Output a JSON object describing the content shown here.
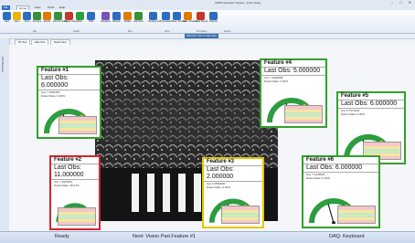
{
  "window": {
    "title": "CMM Inspection System - [Live View]",
    "controls": [
      "–",
      "□",
      "✕"
    ]
  },
  "menu": {
    "tabs": [
      "File",
      "Home",
      "View",
      "Tools",
      "Help"
    ],
    "active": 1
  },
  "ribbon": {
    "buttons": [
      "New",
      "Open",
      "Save",
      "Rename",
      "Export",
      "Recent Library",
      "Delete Library",
      "Part",
      "Hold",
      "Hardware",
      "Refresh",
      "Rotate",
      "Start Run",
      "Viewing Grid",
      "Translation",
      "Save Template",
      "Save Template",
      "Auto Report",
      "Reports"
    ],
    "icon_colors": [
      "#2d6cc0",
      "#f0b400",
      "#2d6cc0",
      "#3a8f3a",
      "#e07a00",
      "#3a8f3a",
      "#c0392b",
      "#2d9d3f",
      "#2d6cc0",
      "#7a4fbf",
      "#2d6cc0",
      "#e07a00",
      "#3a8f3a",
      "#2d6cc0",
      "#2d6cc0",
      "#2d6cc0",
      "#e07a00",
      "#c0392b",
      "#2d6cc0"
    ],
    "groups": [
      "File",
      "Library",
      "Run",
      "View",
      "Templates",
      "Report"
    ]
  },
  "doc": {
    "tabs": [
      "3D View",
      "Data View",
      "Report View"
    ],
    "path": "20221017 3:45:11 Vision Part",
    "left_label": "Part Browser"
  },
  "features": [
    {
      "title": "Feature #1",
      "obs": "Last Obs: 6.000000",
      "cal": "Cal: 7.2393153",
      "defect": "Defect Rate: 0.00%",
      "status": "green"
    },
    {
      "title": "Feature #2",
      "obs": "Last Obs: 11.000000",
      "cal": "Cal: 7.3975657",
      "defect": "Defect Rate: 18.47%",
      "status": "red"
    },
    {
      "title": "Feature #3",
      "obs": "Last Obs: 2.000000",
      "cal": "Cal: 2.0500000",
      "defect": "Defect Rate: 0.00%",
      "status": "yellow"
    },
    {
      "title": "Feature #4",
      "obs": "Last Obs: 5.000000",
      "cal": "Cal: 7.2093658",
      "defect": "Defect Rate: 0.00%",
      "status": "green"
    },
    {
      "title": "Feature #5",
      "obs": "Last Obs: 6.000000",
      "cal": "Cal: 6.7672223",
      "defect": "Defect Rate: 0.00%",
      "status": "green"
    },
    {
      "title": "Feature #6",
      "obs": "Last Obs: 6.000000",
      "cal": "Cal: 7.2225845",
      "defect": "Defect Rate: 0.00%",
      "status": "green"
    }
  ],
  "status": {
    "ready": "Ready",
    "next": "Next: Vision Part.Feature #1",
    "daq": "DAQ: Keyboard"
  }
}
